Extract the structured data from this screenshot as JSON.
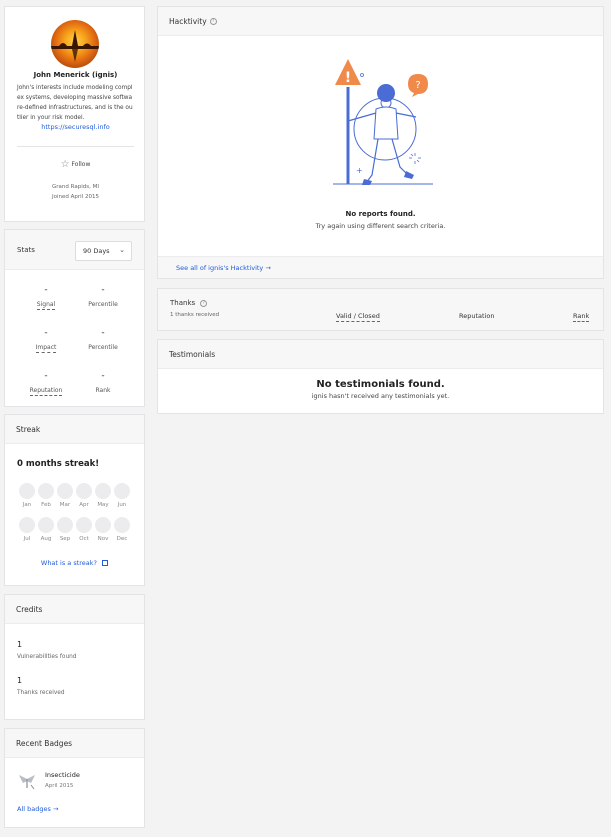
{
  "profile": {
    "name": "John Menerick (ignis)",
    "bio": "John's interests include modeling complex systems, developing massive software-defined infrastructures, and is the outlier in your risk model.",
    "website": "https://securesql.info",
    "follow_label": "Follow",
    "location": "Grand Rapids, MI",
    "joined": "Joined April 2015"
  },
  "stats": {
    "title": "Stats",
    "period": "90 Days",
    "rows": [
      {
        "left_val": "-",
        "left_label": "Signal",
        "right_val": "-",
        "right_label": "Percentile"
      },
      {
        "left_val": "-",
        "left_label": "Impact",
        "right_val": "-",
        "right_label": "Percentile"
      },
      {
        "left_val": "-",
        "left_label": "Reputation",
        "right_val": "-",
        "right_label": "Rank"
      }
    ]
  },
  "streak": {
    "title": "Streak",
    "headline": "0 months streak!",
    "months": [
      "Jan",
      "Feb",
      "Mar",
      "Apr",
      "May",
      "Jun",
      "Jul",
      "Aug",
      "Sep",
      "Oct",
      "Nov",
      "Dec"
    ],
    "link": "What is a streak?"
  },
  "credits": {
    "title": "Credits",
    "items": [
      {
        "value": "1",
        "label": "Vulnerabilities found"
      },
      {
        "value": "1",
        "label": "Thanks received"
      }
    ]
  },
  "badges": {
    "title": "Recent Badges",
    "items": [
      {
        "name": "Insecticide",
        "date": "April 2015"
      }
    ],
    "link": "All badges"
  },
  "hacktivity": {
    "title": "Hacktivity",
    "empty_title": "No reports found.",
    "empty_sub": "Try again using different search criteria.",
    "link": "See all of ignis's Hacktivity"
  },
  "thanks": {
    "title": "Thanks",
    "count": "1 thanks received",
    "col_valid": "Valid / Closed",
    "col_reputation": "Reputation",
    "col_rank": "Rank"
  },
  "testimonials": {
    "title": "Testimonials",
    "empty_title": "No testimonials found.",
    "empty_sub": "ignis hasn't received any testimonials yet."
  },
  "colors": {
    "accent": "#1f5ad9",
    "warning": "#f08a4b",
    "illustration": "#4a6cd4"
  }
}
